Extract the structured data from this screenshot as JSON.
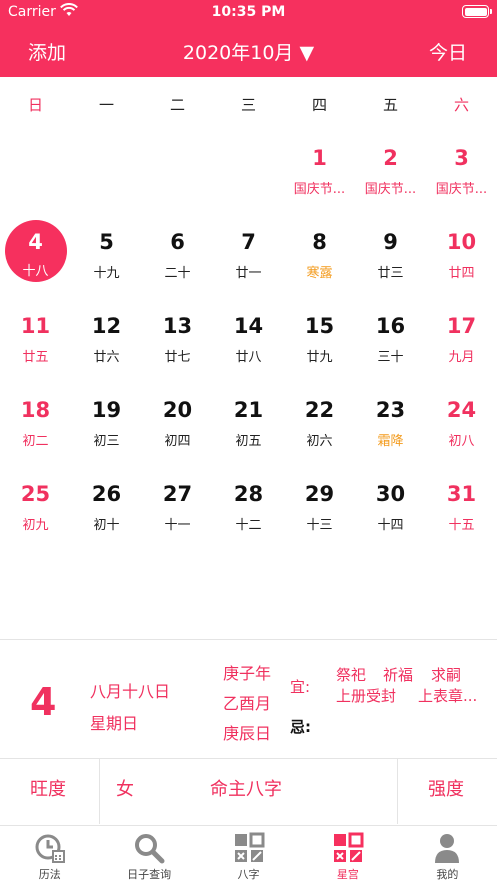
{
  "status_bar": {
    "carrier": "Carrier",
    "time": "10:35 PM"
  },
  "nav": {
    "add_label": "添加",
    "month_label": "2020年10月",
    "dropdown_glyph": "▼",
    "today_label": "今日"
  },
  "weekdays": [
    "日",
    "一",
    "二",
    "三",
    "四",
    "五",
    "六"
  ],
  "calendar": {
    "weeks": [
      [
        {
          "day": "",
          "sub": "",
          "style": "empty"
        },
        {
          "day": "",
          "sub": "",
          "style": "empty"
        },
        {
          "day": "",
          "sub": "",
          "style": "empty"
        },
        {
          "day": "",
          "sub": "",
          "style": "empty"
        },
        {
          "day": "1",
          "sub": "国庆节...",
          "style": "weekend"
        },
        {
          "day": "2",
          "sub": "国庆节...",
          "style": "weekend"
        },
        {
          "day": "3",
          "sub": "国庆节...",
          "style": "weekend"
        }
      ],
      [
        {
          "day": "4",
          "sub": "十八",
          "style": "today"
        },
        {
          "day": "5",
          "sub": "十九",
          "style": "normal"
        },
        {
          "day": "6",
          "sub": "二十",
          "style": "normal"
        },
        {
          "day": "7",
          "sub": "廿一",
          "style": "normal"
        },
        {
          "day": "8",
          "sub": "寒露",
          "style": "term"
        },
        {
          "day": "9",
          "sub": "廿三",
          "style": "normal"
        },
        {
          "day": "10",
          "sub": "廿四",
          "style": "weekend"
        }
      ],
      [
        {
          "day": "11",
          "sub": "廿五",
          "style": "weekend"
        },
        {
          "day": "12",
          "sub": "廿六",
          "style": "normal"
        },
        {
          "day": "13",
          "sub": "廿七",
          "style": "normal"
        },
        {
          "day": "14",
          "sub": "廿八",
          "style": "normal"
        },
        {
          "day": "15",
          "sub": "廿九",
          "style": "normal"
        },
        {
          "day": "16",
          "sub": "三十",
          "style": "normal"
        },
        {
          "day": "17",
          "sub": "九月",
          "style": "weekend"
        }
      ],
      [
        {
          "day": "18",
          "sub": "初二",
          "style": "weekend"
        },
        {
          "day": "19",
          "sub": "初三",
          "style": "normal"
        },
        {
          "day": "20",
          "sub": "初四",
          "style": "normal"
        },
        {
          "day": "21",
          "sub": "初五",
          "style": "normal"
        },
        {
          "day": "22",
          "sub": "初六",
          "style": "normal"
        },
        {
          "day": "23",
          "sub": "霜降",
          "style": "term"
        },
        {
          "day": "24",
          "sub": "初八",
          "style": "weekend"
        }
      ],
      [
        {
          "day": "25",
          "sub": "初九",
          "style": "weekend"
        },
        {
          "day": "26",
          "sub": "初十",
          "style": "normal"
        },
        {
          "day": "27",
          "sub": "十一",
          "style": "normal"
        },
        {
          "day": "28",
          "sub": "十二",
          "style": "normal"
        },
        {
          "day": "29",
          "sub": "十三",
          "style": "normal"
        },
        {
          "day": "30",
          "sub": "十四",
          "style": "normal"
        },
        {
          "day": "31",
          "sub": "十五",
          "style": "weekend"
        }
      ]
    ]
  },
  "detail": {
    "day": "4",
    "lunar_date": "八月十八日",
    "weekday": "星期日",
    "ganzhi_year": "庚子年",
    "ganzhi_month": "乙酉月",
    "ganzhi_day": "庚辰日",
    "yi_label": "宜:",
    "ji_label": "忌:",
    "yi_items": [
      "祭祀",
      "祈福",
      "求嗣",
      "上册受封",
      "上表章..."
    ]
  },
  "bazi_bar": {
    "wangdu": "旺度",
    "gender": "女",
    "title": "命主八字",
    "qiangdu": "强度"
  },
  "tabs": [
    {
      "label": "历法",
      "icon": "calendar-clock-icon"
    },
    {
      "label": "日子查询",
      "icon": "magnifier-icon"
    },
    {
      "label": "八字",
      "icon": "bazi-grid-icon"
    },
    {
      "label": "星宫",
      "icon": "star-palace-icon",
      "active": true
    },
    {
      "label": "我的",
      "icon": "person-icon"
    }
  ],
  "colors": {
    "accent": "#f6305e",
    "term": "#f39b1d",
    "divider": "#e4e4e4"
  }
}
